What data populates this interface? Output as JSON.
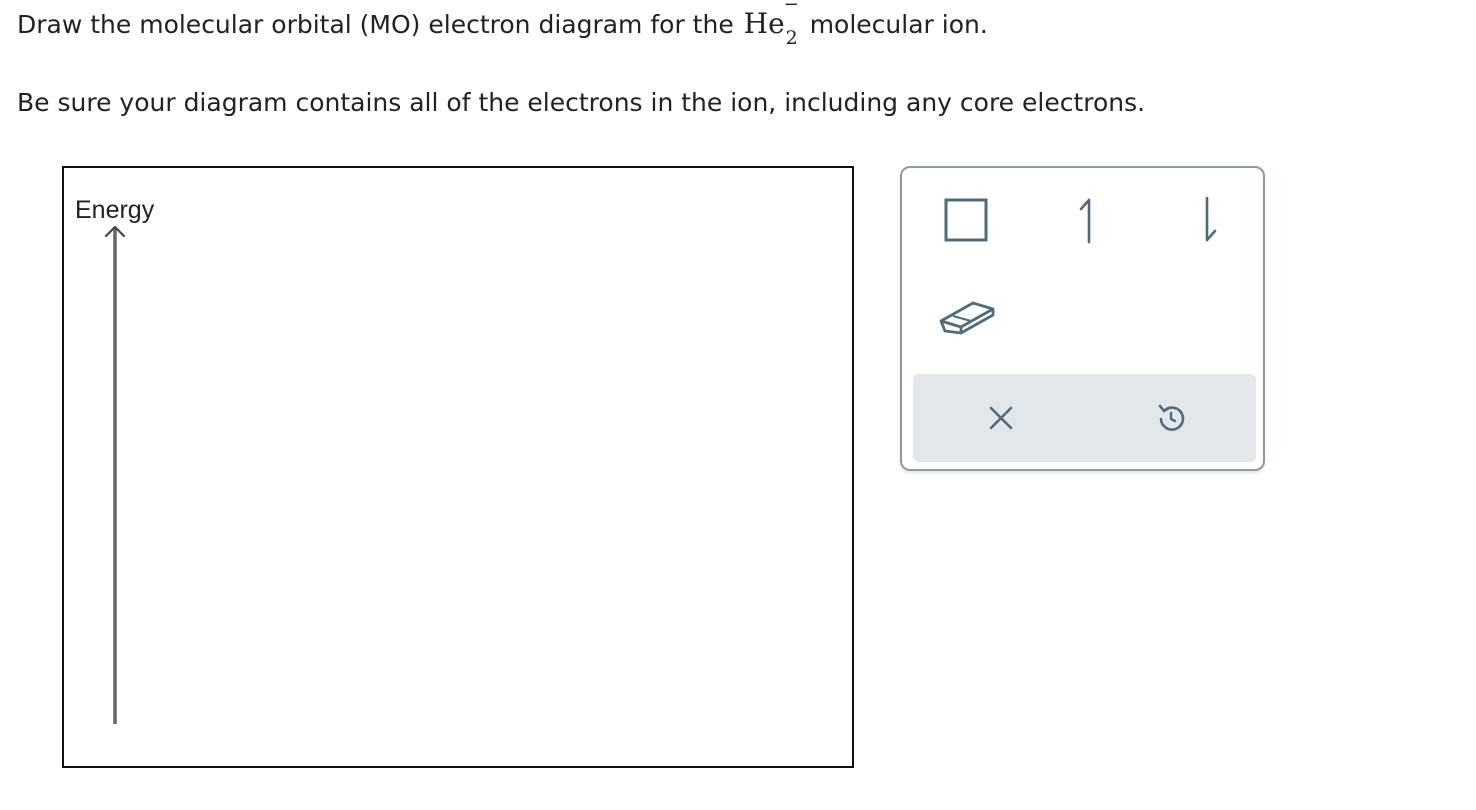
{
  "prompt": {
    "line1_before": "Draw the molecular orbital (MO) electron diagram for the",
    "formula_element": "He",
    "formula_subscript": "2",
    "formula_charge": "−",
    "line1_after": "molecular ion.",
    "line2": "Be sure your diagram contains all of the electrons in the ion, including any core electrons."
  },
  "canvas": {
    "axis_label": "Energy"
  },
  "palette": {
    "tools": [
      {
        "name": "orbital-box",
        "icon": "square-icon"
      },
      {
        "name": "spin-up-electron",
        "icon": "up-half-arrow-icon"
      },
      {
        "name": "spin-down-electron",
        "icon": "down-half-arrow-icon"
      },
      {
        "name": "eraser",
        "icon": "eraser-icon"
      }
    ],
    "actions": [
      {
        "name": "clear",
        "icon": "x-icon"
      },
      {
        "name": "undo",
        "icon": "undo-icon"
      }
    ],
    "colors": {
      "icon": "#4f6b7a",
      "action_bar_bg": "#e1e7ea",
      "border": "#8a9aa6"
    }
  }
}
